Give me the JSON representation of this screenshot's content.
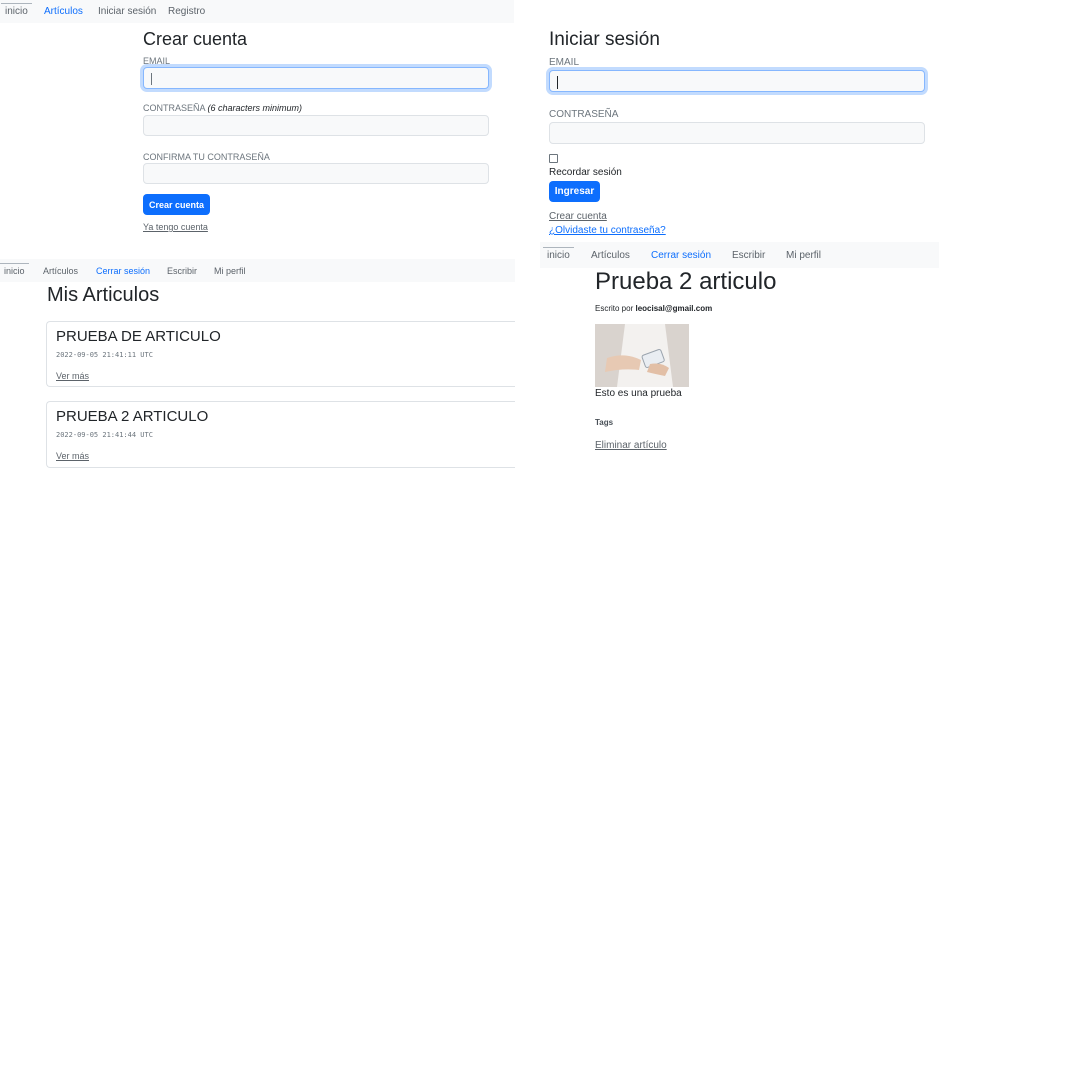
{
  "register_panel": {
    "nav": [
      "inicio",
      "Artículos",
      "Iniciar sesión",
      "Registro"
    ],
    "title": "Crear cuenta",
    "email_label": "EMAIL",
    "password_label": "CONTRASEÑA",
    "password_hint": "(6 characters minimum)",
    "confirm_label": "CONFIRMA TU CONTRASEÑA",
    "submit_label": "Crear cuenta",
    "have_account_link": "Ya tengo cuenta"
  },
  "login_panel": {
    "title": "Iniciar sesión",
    "email_label": "EMAIL",
    "password_label": "CONTRASEÑA",
    "remember_label": "Recordar sesión",
    "submit_label": "Ingresar",
    "create_account_link": "Crear cuenta",
    "forgot_link": "¿Olvidaste tu contraseña?"
  },
  "my_articles_panel": {
    "nav": [
      "inicio",
      "Artículos",
      "Cerrar sesión",
      "Escribir",
      "Mi perfil"
    ],
    "title": "Mis Articulos",
    "articles": [
      {
        "title": "PRUEBA DE ARTICULO",
        "timestamp": "2022-09-05 21:41:11 UTC",
        "link": "Ver más"
      },
      {
        "title": "PRUEBA 2 ARTICULO",
        "timestamp": "2022-09-05 21:41:44 UTC",
        "link": "Ver más"
      }
    ]
  },
  "article_panel": {
    "nav": [
      "inicio",
      "Artículos",
      "Cerrar sesión",
      "Escribir",
      "Mi perfil"
    ],
    "title": "Prueba 2 articulo",
    "byline_prefix": "Escrito por",
    "author": "leocisal@gmail.com",
    "body": "Esto es una prueba",
    "tags_label": "Tags",
    "delete_link": "Eliminar artículo"
  },
  "colors": {
    "primary": "#0d6efd",
    "navbar_bg": "#f8f9fa",
    "text": "#212529",
    "muted": "#6c757d"
  }
}
